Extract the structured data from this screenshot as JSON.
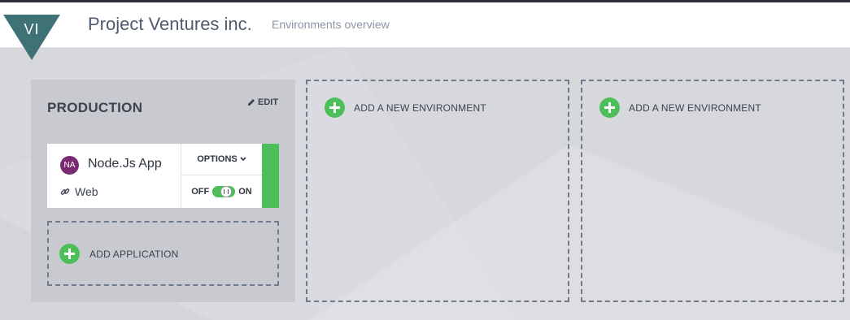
{
  "header": {
    "logo_initials": "VI",
    "company": "Project Ventures inc.",
    "subtitle": "Environments overview"
  },
  "environments": [
    {
      "title": "PRODUCTION",
      "edit_label": "EDIT",
      "apps": [
        {
          "avatar": "NA",
          "name": "Node.Js App",
          "link_label": "Web",
          "options_label": "OPTIONS",
          "toggle_off": "OFF",
          "toggle_on": "ON",
          "enabled": true
        }
      ],
      "add_app_label": "ADD APPLICATION"
    }
  ],
  "add_environment_label": "ADD A NEW ENVIRONMENT",
  "colors": {
    "accent_green": "#4cbf5a",
    "logo_teal": "#3e7277",
    "avatar_purple": "#7a2b74"
  }
}
